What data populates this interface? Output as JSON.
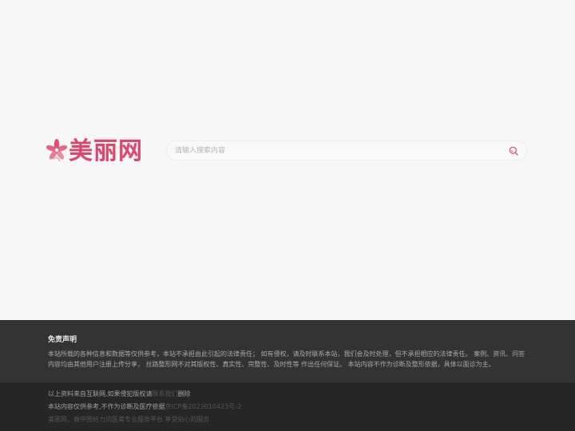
{
  "logo": {
    "text": "美丽网",
    "icon": "flower-icon",
    "color": "#e0466d"
  },
  "search": {
    "placeholder": "请输入搜索内容",
    "value": "",
    "icon": "search-icon"
  },
  "footer": {
    "disclaimer_title": "免责声明",
    "disclaimer_text": "本站所载的各种信息和数据等仅供参考，本站不承担由此引起的法律责任； 如有侵权，请及时联系本站，我们会及时处理，但不承担相应的法律责任。 案例、资讯、问答内容均由其他用户注册上传分享， 丝路整形网不对其版权性、真实性、完整性、及时性等 作出任何保证。 本站内容不作为诊断及整形依据，具体以面诊为主。",
    "line1_prefix": "以上资料来自互联网,如果侵犯版权请",
    "line1_dim": "联系我们",
    "line1_link": "删除",
    "line2_prefix": "本站内容仅供参考,不作为诊断及医疗依据",
    "line2_dim": "京ICP备2023010423号-2",
    "line3": "美丽网，做中国给力的医美专业服务平台 享受贴心的服务"
  },
  "colors": {
    "brand": "#e0466d",
    "footer_top_bg": "#333333",
    "footer_bottom_bg": "#262626"
  }
}
